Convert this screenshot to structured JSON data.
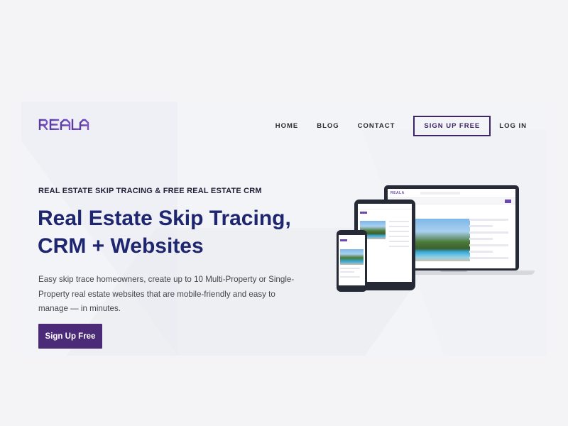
{
  "brand": {
    "logo_text": "REALA",
    "accent_color": "#6a48b0",
    "dark_purple": "#4b2a77",
    "headline_color": "#1f2670"
  },
  "nav": {
    "items": [
      {
        "label": "HOME"
      },
      {
        "label": "BLOG"
      },
      {
        "label": "CONTACT"
      }
    ],
    "signup_label": "SIGN UP FREE",
    "login_label": "LOG IN"
  },
  "hero": {
    "eyebrow": "REAL ESTATE SKIP TRACING & FREE REAL ESTATE CRM",
    "headline_line1": "Real Estate Skip Tracing,",
    "headline_line2": "CRM + Websites",
    "description": "Easy skip trace homeowners, create up to 10 Multi-Property or Single-Property real estate websites that are mobile-friendly and easy to manage — in minutes.",
    "cta_label": "Sign Up Free"
  },
  "devices": {
    "laptop_logo": "REALA"
  }
}
